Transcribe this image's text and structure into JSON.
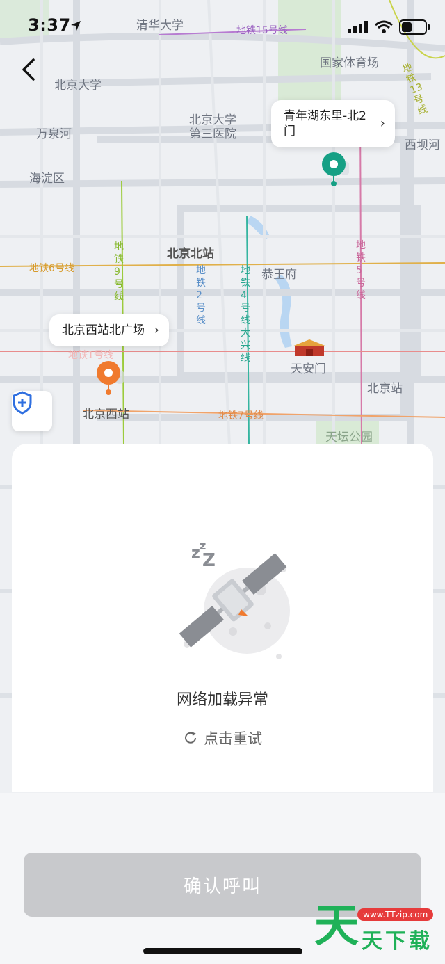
{
  "status_bar": {
    "time": "3:37"
  },
  "map": {
    "labels": {
      "tsinghua": "清华大学",
      "line15": "地铁15号线",
      "guojiatiyuchang": "国家体育场",
      "pku": "北京大学",
      "pku3": "北京大学",
      "pku3b": "第三医院",
      "wanquanhe": "万泉河",
      "xibahe": "西坝河",
      "haidian": "海淀区",
      "beijingbei": "北京北站",
      "gongwangfu": "恭王府",
      "line6": "地铁6号线",
      "line9": "地铁9号线",
      "line2": "地铁2号线",
      "line4": "地铁4号线大兴线",
      "line5": "地铁5号线",
      "line13": "地铁13号线",
      "tiananmen": "天安门",
      "beijingzhan": "北京站",
      "beijingxi": "北京西站",
      "line7": "地铁7号线",
      "line1_faded": "地铁1号线",
      "tiantan": "天坛公园"
    },
    "start_callout": "北京西站北广场",
    "end_callout": "青年湖东里-北2门",
    "pin_start_color": "#f07a2e",
    "pin_end_color": "#16a085"
  },
  "panel": {
    "error_title": "网络加载异常",
    "retry_label": "点击重试"
  },
  "confirm_button": "确认呼叫",
  "watermark": {
    "big": "天",
    "url": "www.TTzip.com",
    "text": "天下载"
  }
}
